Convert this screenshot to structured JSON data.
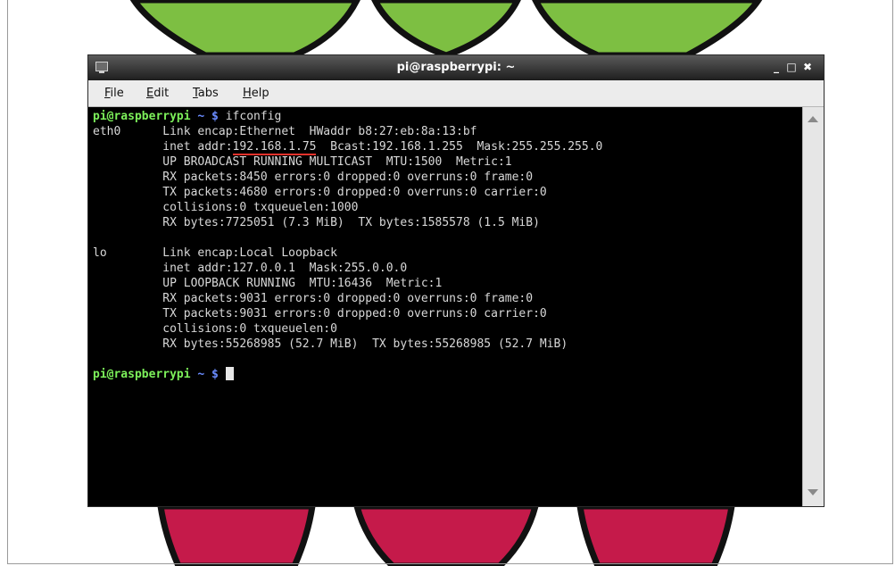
{
  "window": {
    "title": "pi@raspberrypi: ~",
    "controls": {
      "minimize": "_",
      "maximize": "□",
      "close": "✖"
    }
  },
  "menu": {
    "file": {
      "mnemonic": "F",
      "rest": "ile"
    },
    "edit": {
      "mnemonic": "E",
      "rest": "dit"
    },
    "tabs": {
      "mnemonic": "T",
      "rest": "abs"
    },
    "help": {
      "mnemonic": "H",
      "rest": "elp"
    }
  },
  "terminal": {
    "prompt_user": "pi@raspberrypi",
    "prompt_path": "~ $",
    "command": "ifconfig",
    "lines": {
      "eth0_1": "eth0      Link encap:Ethernet  HWaddr b8:27:eb:8a:13:bf",
      "eth0_2_prefix": "          inet addr:",
      "eth0_2_ip": "192.168.1.75",
      "eth0_2_suffix": "  Bcast:192.168.1.255  Mask:255.255.255.0",
      "eth0_3": "          UP BROADCAST RUNNING MULTICAST  MTU:1500  Metric:1",
      "eth0_4": "          RX packets:8450 errors:0 dropped:0 overruns:0 frame:0",
      "eth0_5": "          TX packets:4680 errors:0 dropped:0 overruns:0 carrier:0",
      "eth0_6": "          collisions:0 txqueuelen:1000",
      "eth0_7": "          RX bytes:7725051 (7.3 MiB)  TX bytes:1585578 (1.5 MiB)",
      "lo_1": "lo        Link encap:Local Loopback",
      "lo_2": "          inet addr:127.0.0.1  Mask:255.0.0.0",
      "lo_3": "          UP LOOPBACK RUNNING  MTU:16436  Metric:1",
      "lo_4": "          RX packets:9031 errors:0 dropped:0 overruns:0 frame:0",
      "lo_5": "          TX packets:9031 errors:0 dropped:0 overruns:0 carrier:0",
      "lo_6": "          collisions:0 txqueuelen:0",
      "lo_7": "          RX bytes:55268985 (52.7 MiB)  TX bytes:55268985 (52.7 MiB)"
    }
  },
  "colors": {
    "leaf_green": "#7dbf42",
    "berry_red": "#c51a4a",
    "prompt_green": "#7cf05a",
    "prompt_blue": "#6a8cff",
    "ip_underline": "#e4322b"
  },
  "icons": {
    "app": "terminal-icon",
    "scroll_up": "scroll-up-arrow-icon",
    "scroll_down": "scroll-down-arrow-icon"
  }
}
